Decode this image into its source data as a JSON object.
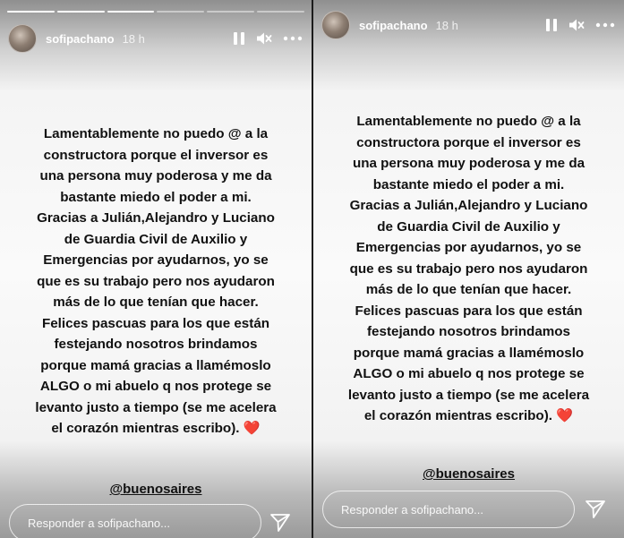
{
  "story": {
    "username": "sofipachano",
    "time": "18 h",
    "text": "Lamentablemente no puedo @ a la\nconstructora porque el inversor es\nuna persona muy poderosa y me da\nbastante miedo el poder a mi.\nGracias a Julián,Alejandro  y Luciano\nde Guardia Civil de Auxilio y\nEmergencias por ayudarnos, yo se\nque es su trabajo pero nos ayudaron\nmás de lo que tenían que hacer.\nFelices pascuas para los que están\nfestejando nosotros brindamos\nporque mamá gracias a llamémoslo\nALGO o mi abuelo q nos protege se\nlevanto justo a tiempo (se me acelera\nel corazón mientras escribo).",
    "heart": "❤️",
    "mention": "@buenosaires",
    "reply_placeholder": "Responder a sofipachano...",
    "progress_segments": 6,
    "progress_current": 3
  },
  "icons": {
    "pause": "pause-icon",
    "mute": "speaker-muted-icon",
    "more": "more-horizontal-icon",
    "send": "paper-plane-send-icon"
  },
  "colors": {
    "text": "#111111",
    "heart": "#e0141e",
    "ui_white": "#ffffff"
  }
}
